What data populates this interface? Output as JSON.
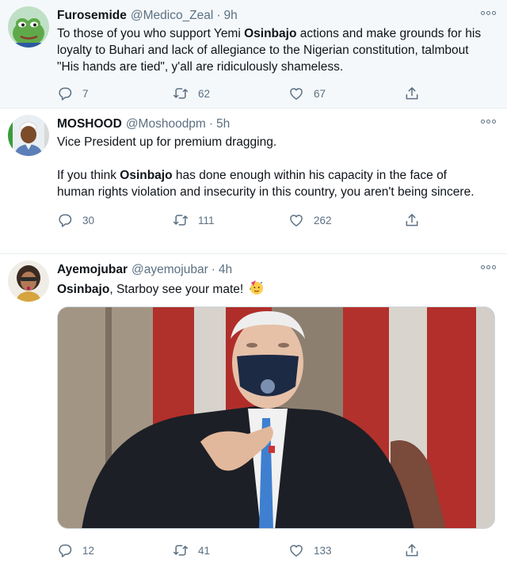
{
  "tweets": [
    {
      "name": "Furosemide",
      "handle": "@Medico_Zeal",
      "time": "9h",
      "text_before": "To those of you who support Yemi ",
      "highlight": "Osinbajo",
      "text_after": " actions and make grounds for his loyalty to Buhari and lack of allegiance to the Nigerian constitution, talmbout \"His hands are tied\", y'all are ridiculously shameless.",
      "replies": "7",
      "retweets": "62",
      "likes": "67"
    },
    {
      "name": "MOSHOOD",
      "handle": "@Moshoodpm",
      "time": "5h",
      "line1": "Vice President up for premium dragging.",
      "text_before": "If you think ",
      "highlight": "Osinbajo",
      "text_after": " has done enough within his capacity in the face of human rights violation and insecurity in this country, you aren't being sincere.",
      "replies": "30",
      "retweets": "111",
      "likes": "262"
    },
    {
      "name": "Ayemojubar",
      "handle": "@ayemojubar",
      "time": "4h",
      "highlight": "Osinbajo",
      "text_after": ", Starboy see your mate!",
      "emoji": "partying-face",
      "replies": "12",
      "retweets": "41",
      "likes": "133"
    }
  ],
  "separator": "·",
  "colors": {
    "muted": "#5b7083",
    "text": "#0f1419",
    "first_tweet_bg": "#f5f8fa",
    "divider": "#e6ecf0"
  }
}
